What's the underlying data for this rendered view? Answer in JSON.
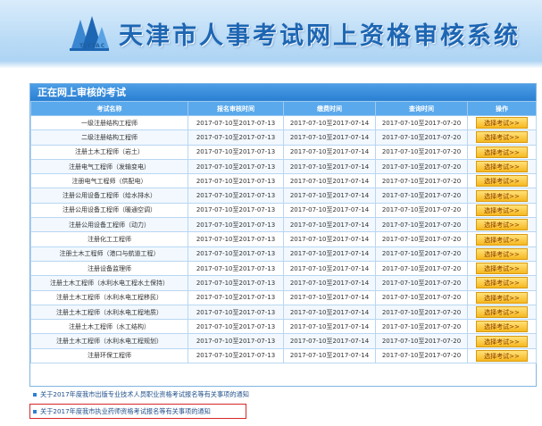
{
  "header": {
    "logo_text": "TJTTAC",
    "title": "天津市人事考试网上资格审核系统"
  },
  "panel": {
    "title": "正在网上审核的考试",
    "columns": [
      "考试名称",
      "报名审核时间",
      "缴费时间",
      "查询时间",
      "操作"
    ],
    "rows": [
      {
        "name": "一级注册结构工程师",
        "reg": "2017-07-10至2017-07-13",
        "pay": "2017-07-10至2017-07-14",
        "query": "2017-07-10至2017-07-20",
        "action": "选择考试>>"
      },
      {
        "name": "二级注册结构工程师",
        "reg": "2017-07-10至2017-07-13",
        "pay": "2017-07-10至2017-07-14",
        "query": "2017-07-10至2017-07-20",
        "action": "选择考试>>"
      },
      {
        "name": "注册土木工程师（岩土）",
        "reg": "2017-07-10至2017-07-13",
        "pay": "2017-07-10至2017-07-14",
        "query": "2017-07-10至2017-07-20",
        "action": "选择考试>>"
      },
      {
        "name": "注册电气工程师（发输变电）",
        "reg": "2017-07-10至2017-07-13",
        "pay": "2017-07-10至2017-07-14",
        "query": "2017-07-10至2017-07-20",
        "action": "选择考试>>"
      },
      {
        "name": "注册电气工程师（供配电）",
        "reg": "2017-07-10至2017-07-13",
        "pay": "2017-07-10至2017-07-14",
        "query": "2017-07-10至2017-07-20",
        "action": "选择考试>>"
      },
      {
        "name": "注册公用设备工程师（给水排水）",
        "reg": "2017-07-10至2017-07-13",
        "pay": "2017-07-10至2017-07-14",
        "query": "2017-07-10至2017-07-20",
        "action": "选择考试>>"
      },
      {
        "name": "注册公用设备工程师（暖通空调）",
        "reg": "2017-07-10至2017-07-13",
        "pay": "2017-07-10至2017-07-14",
        "query": "2017-07-10至2017-07-20",
        "action": "选择考试>>"
      },
      {
        "name": "注册公用设备工程师（动力）",
        "reg": "2017-07-10至2017-07-13",
        "pay": "2017-07-10至2017-07-14",
        "query": "2017-07-10至2017-07-20",
        "action": "选择考试>>"
      },
      {
        "name": "注册化工工程师",
        "reg": "2017-07-10至2017-07-13",
        "pay": "2017-07-10至2017-07-14",
        "query": "2017-07-10至2017-07-20",
        "action": "选择考试>>"
      },
      {
        "name": "注册土木工程师（港口与航道工程）",
        "reg": "2017-07-10至2017-07-13",
        "pay": "2017-07-10至2017-07-14",
        "query": "2017-07-10至2017-07-20",
        "action": "选择考试>>"
      },
      {
        "name": "注册设备监理师",
        "reg": "2017-07-10至2017-07-13",
        "pay": "2017-07-10至2017-07-14",
        "query": "2017-07-10至2017-07-20",
        "action": "选择考试>>"
      },
      {
        "name": "注册土木工程师（水利水电工程水土保持）",
        "reg": "2017-07-10至2017-07-13",
        "pay": "2017-07-10至2017-07-14",
        "query": "2017-07-10至2017-07-20",
        "action": "选择考试>>"
      },
      {
        "name": "注册土木工程师（水利水电工程移民）",
        "reg": "2017-07-10至2017-07-13",
        "pay": "2017-07-10至2017-07-14",
        "query": "2017-07-10至2017-07-20",
        "action": "选择考试>>"
      },
      {
        "name": "注册土木工程师（水利水电工程地质）",
        "reg": "2017-07-10至2017-07-13",
        "pay": "2017-07-10至2017-07-14",
        "query": "2017-07-10至2017-07-20",
        "action": "选择考试>>"
      },
      {
        "name": "注册土木工程师（水工结构）",
        "reg": "2017-07-10至2017-07-13",
        "pay": "2017-07-10至2017-07-14",
        "query": "2017-07-10至2017-07-20",
        "action": "选择考试>>"
      },
      {
        "name": "注册土木工程师（水利水电工程规划）",
        "reg": "2017-07-10至2017-07-13",
        "pay": "2017-07-10至2017-07-14",
        "query": "2017-07-10至2017-07-20",
        "action": "选择考试>>"
      },
      {
        "name": "注册环保工程师",
        "reg": "2017-07-10至2017-07-13",
        "pay": "2017-07-10至2017-07-14",
        "query": "2017-07-10至2017-07-20",
        "action": "选择考试>>"
      }
    ]
  },
  "notices": [
    "关于2017年度我市出版专业技术人员职业资格考试报名等有关事项的通知",
    "关于2017年度我市执业药师资格考试报名等有关事项的通知"
  ],
  "colors": {
    "accent": "#2a7fd2",
    "button": "#f6b820",
    "highlight_border": "#d6282a"
  }
}
